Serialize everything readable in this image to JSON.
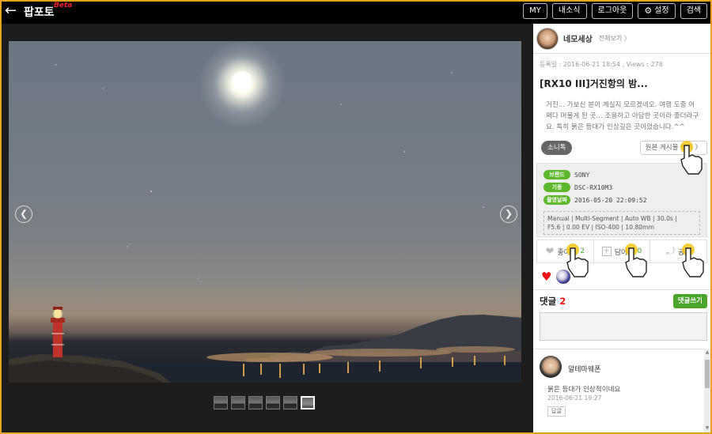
{
  "header": {
    "back_icon": "arrow-left-icon",
    "logo": "팝포토",
    "logo_badge": "Beta",
    "buttons": [
      {
        "label": "MY"
      },
      {
        "label": "내소식"
      },
      {
        "label": "로그아웃"
      },
      {
        "label": "설정",
        "icon": "gear-icon"
      },
      {
        "label": "검색"
      }
    ]
  },
  "viewer": {
    "thumbnail_count": 6,
    "active_thumbnail": 6
  },
  "post": {
    "author": "네모세상",
    "author_link": "전체보기 〉",
    "meta": "등록일 : 2016-06-21 18:54 , Views : 278",
    "title": "[RX10 III]거진항의 밤...",
    "body": "거진... 가보신 분이 계실지 모르겠네오. 여행 도중 어쩌다 머물게 된 곳... 조용하고 아담한 곳이라 좋더라구요. 특히 붉은 등대가 인상깊은 곳이었습니다.^^",
    "tag": "소니톡",
    "original_link": "원본 게시물 보기 〉"
  },
  "exif": {
    "brand_label": "브랜드",
    "brand": "SONY",
    "model_label": "기종",
    "model": "DSC-RX10M3",
    "date_label": "촬영날짜",
    "date": "2016-05-20 22:09:52",
    "line1": "Manual  |  Multi-Segment  |  Auto WB  |  30.0s  |",
    "line2": "F5.6  |  0.00 EV  |  ISO-400  |  10.80mm"
  },
  "actions": {
    "like_label": "좋아요",
    "like_count": "2",
    "save_label": "담아요",
    "save_count": "0",
    "share_label": "공유"
  },
  "comments": {
    "title": "댓글",
    "count": "2",
    "write_button": "댓글쓰기",
    "items": [
      {
        "name": "알테마웨폰",
        "text": "붉은 등대가 인상적이네요",
        "date": "2016-06-21 19:27",
        "reply": "답글"
      }
    ]
  },
  "colors": {
    "frame": "#e8a41c",
    "accent_green": "#4aa52a",
    "heart": "#e11111"
  }
}
